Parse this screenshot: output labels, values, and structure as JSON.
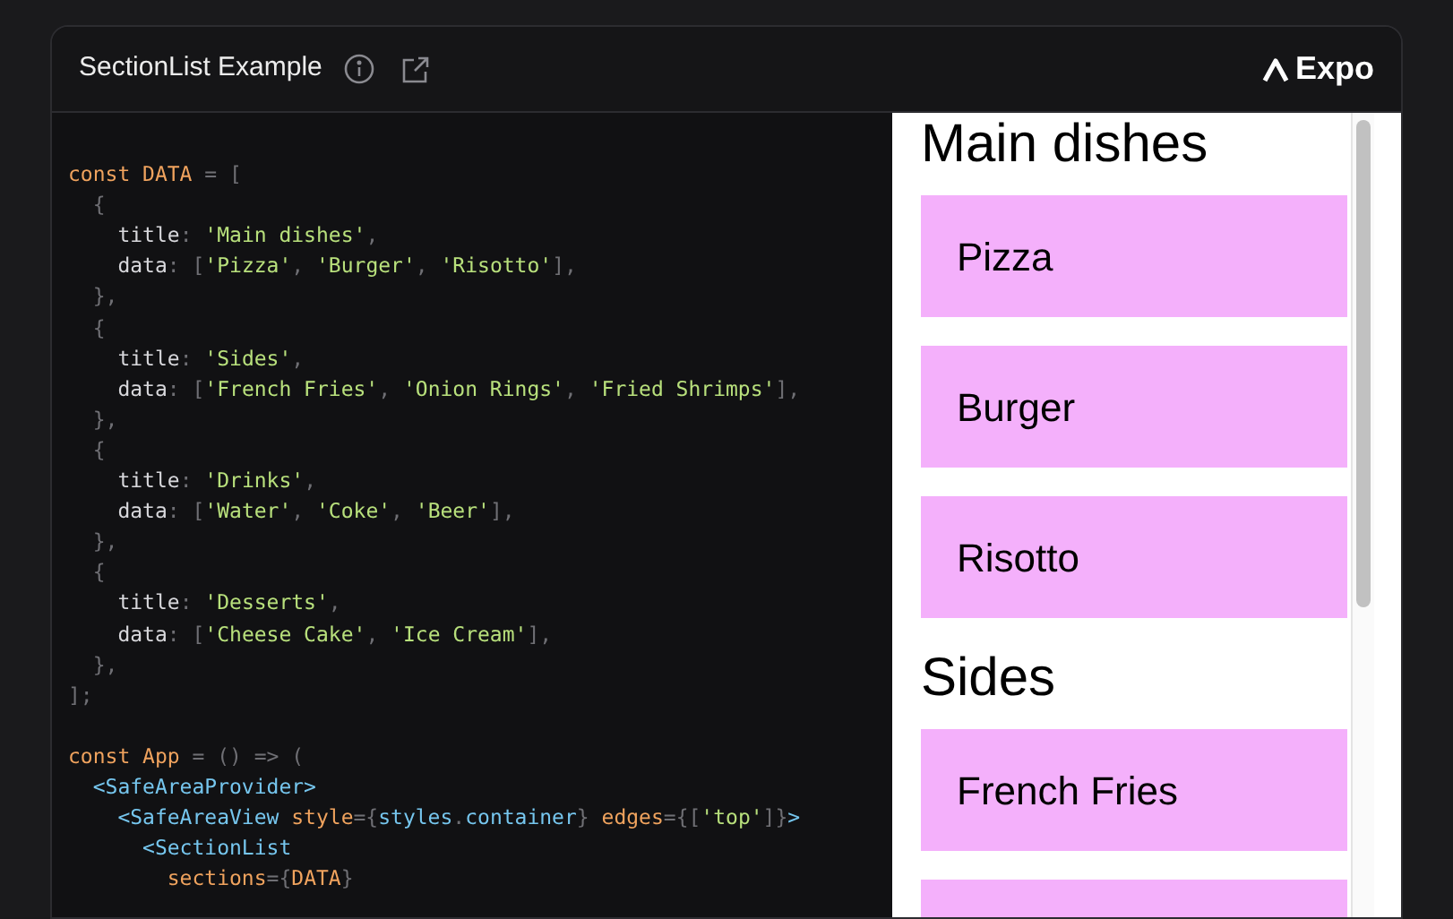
{
  "header": {
    "title": "SectionList Example",
    "brand": "Expo"
  },
  "code_lines": [
    {
      "blank_before": true,
      "tokens": [
        {
          "kind": "kw",
          "text": "const DATA"
        },
        {
          "kind": "punct",
          "text": " = ["
        }
      ]
    },
    {
      "tokens": [
        {
          "kind": "punct",
          "text": "  {"
        }
      ]
    },
    {
      "tokens": [
        {
          "kind": "plain",
          "text": "    title"
        },
        {
          "kind": "punct",
          "text": ": "
        },
        {
          "kind": "str",
          "text": "'Main dishes'"
        },
        {
          "kind": "punct",
          "text": ","
        }
      ]
    },
    {
      "tokens": [
        {
          "kind": "plain",
          "text": "    data"
        },
        {
          "kind": "punct",
          "text": ": ["
        },
        {
          "kind": "str",
          "text": "'Pizza'"
        },
        {
          "kind": "punct",
          "text": ", "
        },
        {
          "kind": "str",
          "text": "'Burger'"
        },
        {
          "kind": "punct",
          "text": ", "
        },
        {
          "kind": "str",
          "text": "'Risotto'"
        },
        {
          "kind": "punct",
          "text": "],"
        }
      ]
    },
    {
      "tokens": [
        {
          "kind": "punct",
          "text": "  },"
        }
      ]
    },
    {
      "tokens": [
        {
          "kind": "punct",
          "text": "  {"
        }
      ]
    },
    {
      "tokens": [
        {
          "kind": "plain",
          "text": "    title"
        },
        {
          "kind": "punct",
          "text": ": "
        },
        {
          "kind": "str",
          "text": "'Sides'"
        },
        {
          "kind": "punct",
          "text": ","
        }
      ]
    },
    {
      "tokens": [
        {
          "kind": "plain",
          "text": "    data"
        },
        {
          "kind": "punct",
          "text": ": ["
        },
        {
          "kind": "str",
          "text": "'French Fries'"
        },
        {
          "kind": "punct",
          "text": ", "
        },
        {
          "kind": "str",
          "text": "'Onion Rings'"
        },
        {
          "kind": "punct",
          "text": ", "
        },
        {
          "kind": "str",
          "text": "'Fried Shrimps'"
        },
        {
          "kind": "punct",
          "text": "],"
        }
      ]
    },
    {
      "tokens": [
        {
          "kind": "punct",
          "text": "  },"
        }
      ]
    },
    {
      "tokens": [
        {
          "kind": "punct",
          "text": "  {"
        }
      ]
    },
    {
      "tokens": [
        {
          "kind": "plain",
          "text": "    title"
        },
        {
          "kind": "punct",
          "text": ": "
        },
        {
          "kind": "str",
          "text": "'Drinks'"
        },
        {
          "kind": "punct",
          "text": ","
        }
      ]
    },
    {
      "tokens": [
        {
          "kind": "plain",
          "text": "    data"
        },
        {
          "kind": "punct",
          "text": ": ["
        },
        {
          "kind": "str",
          "text": "'Water'"
        },
        {
          "kind": "punct",
          "text": ", "
        },
        {
          "kind": "str",
          "text": "'Coke'"
        },
        {
          "kind": "punct",
          "text": ", "
        },
        {
          "kind": "str",
          "text": "'Beer'"
        },
        {
          "kind": "punct",
          "text": "],"
        }
      ]
    },
    {
      "tokens": [
        {
          "kind": "punct",
          "text": "  },"
        }
      ]
    },
    {
      "tokens": [
        {
          "kind": "punct",
          "text": "  {"
        }
      ]
    },
    {
      "tokens": [
        {
          "kind": "plain",
          "text": "    title"
        },
        {
          "kind": "punct",
          "text": ": "
        },
        {
          "kind": "str",
          "text": "'Desserts'"
        },
        {
          "kind": "punct",
          "text": ","
        }
      ]
    },
    {
      "tokens": [
        {
          "kind": "plain",
          "text": "    data"
        },
        {
          "kind": "punct",
          "text": ": ["
        },
        {
          "kind": "str",
          "text": "'Cheese Cake'"
        },
        {
          "kind": "punct",
          "text": ", "
        },
        {
          "kind": "str",
          "text": "'Ice Cream'"
        },
        {
          "kind": "punct",
          "text": "],"
        }
      ]
    },
    {
      "tokens": [
        {
          "kind": "punct",
          "text": "  },"
        }
      ]
    },
    {
      "tokens": [
        {
          "kind": "punct",
          "text": "];"
        }
      ]
    },
    {
      "blank_before": true,
      "tokens": [
        {
          "kind": "kw",
          "text": "const App"
        },
        {
          "kind": "punct",
          "text": " = () => ("
        }
      ]
    },
    {
      "tokens": [
        {
          "kind": "tag",
          "text": "  <SafeAreaProvider>"
        }
      ]
    },
    {
      "tokens": [
        {
          "kind": "tag",
          "text": "    <SafeAreaView"
        },
        {
          "kind": "kw",
          "text": " style"
        },
        {
          "kind": "punct",
          "text": "={"
        },
        {
          "kind": "tag",
          "text": "styles"
        },
        {
          "kind": "punct",
          "text": "."
        },
        {
          "kind": "tag",
          "text": "container"
        },
        {
          "kind": "punct",
          "text": "}"
        },
        {
          "kind": "kw",
          "text": " edges"
        },
        {
          "kind": "punct",
          "text": "={["
        },
        {
          "kind": "str",
          "text": "'top'"
        },
        {
          "kind": "punct",
          "text": "]}"
        },
        {
          "kind": "tag",
          "text": ">"
        }
      ]
    },
    {
      "tokens": [
        {
          "kind": "tag",
          "text": "      <SectionList"
        }
      ]
    },
    {
      "tokens": [
        {
          "kind": "kw",
          "text": "        sections"
        },
        {
          "kind": "punct",
          "text": "={"
        },
        {
          "kind": "kw",
          "text": "DATA"
        },
        {
          "kind": "punct",
          "text": "}"
        }
      ]
    }
  ],
  "preview": [
    {
      "kind": "header",
      "text": "Main dishes"
    },
    {
      "kind": "item",
      "text": "Pizza"
    },
    {
      "kind": "item",
      "text": "Burger"
    },
    {
      "kind": "item",
      "text": "Risotto"
    },
    {
      "kind": "header",
      "text": "Sides"
    },
    {
      "kind": "item",
      "text": "French Fries"
    },
    {
      "kind": "item"
    }
  ]
}
